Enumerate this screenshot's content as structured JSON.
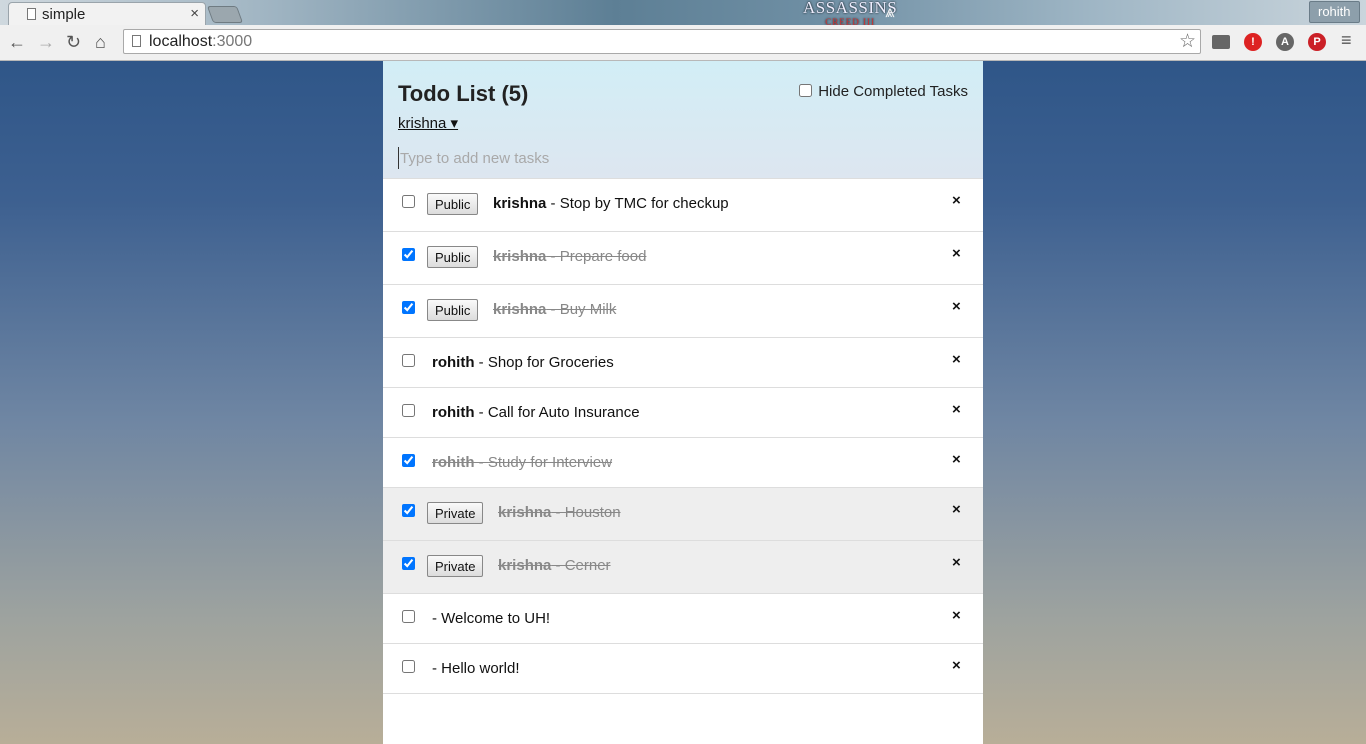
{
  "browser": {
    "tab_title": "simple",
    "tab_close": "×",
    "logo_text": "ASSASSINS",
    "logo_sub": "CREED III",
    "profile_name": "rohith",
    "url_host": "localhost",
    "url_port": ":3000"
  },
  "app": {
    "title": "Todo List (5)",
    "hide_completed_label": "Hide Completed Tasks",
    "account_label": "krishna ▾",
    "new_task_placeholder": "Type to add new tasks",
    "delete_glyph": "×",
    "tasks": [
      {
        "checked": false,
        "button": "Public",
        "username": "krishna",
        "text": " - Stop by TMC for checkup"
      },
      {
        "checked": true,
        "button": "Public",
        "username": "krishna",
        "text": " - Prepare food"
      },
      {
        "checked": true,
        "button": "Public",
        "username": "krishna",
        "text": " - Buy Milk"
      },
      {
        "checked": false,
        "button": "",
        "username": "rohith",
        "text": " - Shop for Groceries"
      },
      {
        "checked": false,
        "button": "",
        "username": "rohith",
        "text": " - Call for Auto Insurance"
      },
      {
        "checked": true,
        "button": "",
        "username": "rohith",
        "text": " - Study for Interview"
      },
      {
        "checked": true,
        "button": "Private",
        "username": "krishna",
        "text": " - Houston"
      },
      {
        "checked": true,
        "button": "Private",
        "username": "krishna",
        "text": " - Cerner"
      },
      {
        "checked": false,
        "button": "",
        "username": "",
        "text": "- Welcome to UH!"
      },
      {
        "checked": false,
        "button": "",
        "username": "",
        "text": "- Hello world!"
      }
    ]
  }
}
